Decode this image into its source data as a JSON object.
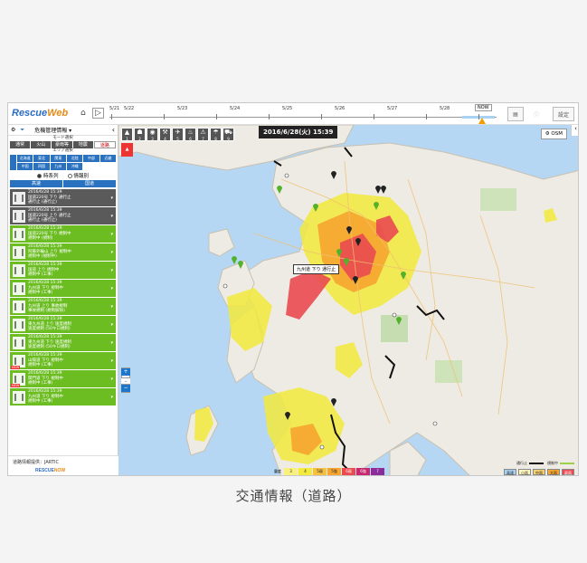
{
  "app": {
    "logo_part1": "Rescue",
    "logo_part2": "Web",
    "settings_label": "設定"
  },
  "timeline": {
    "ticks": [
      "5/21",
      "5/22",
      "5/23",
      "5/24",
      "5/25",
      "5/26",
      "5/27",
      "5/28"
    ],
    "now_label": "NOW"
  },
  "sidebar": {
    "title": "危機管理情報 ▾",
    "mode_label": "モード選択",
    "modes": [
      "通常",
      "火山",
      "豪雨等",
      "地震",
      "道路"
    ],
    "area_label": "エリア選択",
    "areas": [
      "北海道",
      "東北",
      "関東",
      "北陸",
      "中部",
      "近畿",
      "中国",
      "四国",
      "九州",
      "沖縄"
    ],
    "radio_timeline": "時系列",
    "radio_category": "情報別",
    "tab_express": "高速",
    "tab_national": "国道",
    "items": [
      {
        "line1": "2016/6/28 15:39",
        "line2": "国道220号 下り 通行止",
        "line3": "通行止 (通行止)",
        "style": "dark"
      },
      {
        "line1": "2016/6/28 15:39",
        "line2": "国道220号 上り 通行止",
        "line3": "通行止 (通行止)",
        "style": "dark"
      },
      {
        "line1": "2016/6/28 15:39",
        "line2": "国道220号 下り 規制中",
        "line3": "規制中 (規制)",
        "style": "green"
      },
      {
        "line1": "2016/6/28 15:39",
        "line2": "阿蘇外輪山 上り 規制中",
        "line3": "規制中 (規制中)",
        "style": "green"
      },
      {
        "line1": "2016/6/28 15:39",
        "line2": "国道 上り 規制中",
        "line3": "規制中 (工事)",
        "style": "green"
      },
      {
        "line1": "2016/6/28 15:39",
        "line2": "九州道 下り 規制中",
        "line3": "規制中 (工事)",
        "style": "green"
      },
      {
        "line1": "2016/6/28 15:39",
        "line2": "九州道 上り 事故規制",
        "line3": "事故規制 (規制解除)",
        "style": "green"
      },
      {
        "line1": "2016/6/28 15:39",
        "line2": "東九州道 上り 速度規制",
        "line3": "速度規制 (50キロ規制)",
        "style": "green"
      },
      {
        "line1": "2016/6/28 15:39",
        "line2": "東九州道 下り 速度規制",
        "line3": "速度規制 (50キロ規制)",
        "style": "green"
      },
      {
        "line1": "2016/6/28 15:39",
        "line2": "山陽道 下り 規制中",
        "line3": "規制中 (工事)",
        "style": "green",
        "new": true
      },
      {
        "line1": "2016/6/28 15:39",
        "line2": "関門道 下り 規制中",
        "line3": "規制中 (工事)",
        "style": "green",
        "new": true
      },
      {
        "line1": "2016/6/28 15:39",
        "line2": "九州道 下り 規制中",
        "line3": "規制中 (工事)",
        "style": "green"
      }
    ],
    "new_badge": "NEW",
    "source": "道路情報提供：JARTIC",
    "footer_logo1": "RESCUE",
    "footer_logo2": "NOW"
  },
  "map": {
    "datetime": "2016/6/28(火) 15:39",
    "osm_label": "OSM",
    "tools": [
      "1",
      "2",
      "3",
      "4",
      "5",
      "6",
      "7",
      "8",
      "9"
    ],
    "popup": "九州道 下り 通行止",
    "legend_levels": [
      "3",
      "4",
      "5弱",
      "5強",
      "6弱",
      "6強",
      "7"
    ],
    "legend_right_line1": "通行止",
    "legend_right_line2": "規制中",
    "legend_right_buttons": [
      "高速",
      "小雨",
      "中雨",
      "大雨",
      "豪雨"
    ]
  },
  "caption": "交通情報（道路）",
  "colors": {
    "sea": "#b6d7f4",
    "land": "#eeebe4",
    "yellow": "#f2ea3c",
    "orange": "#f6a530",
    "red": "#ea4a50",
    "green_pin": "#52b22c",
    "item_green": "#6bbd22",
    "item_dark": "#5a5a5a",
    "brand_blue": "#2b6cc4",
    "brand_orange": "#e88a16"
  }
}
